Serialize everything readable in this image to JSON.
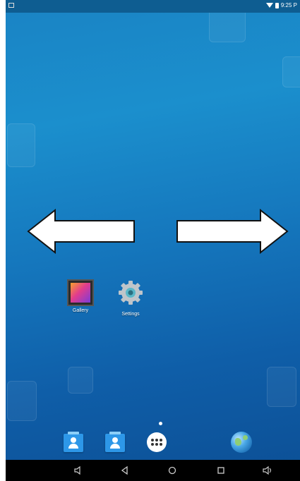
{
  "status_bar": {
    "time": "9:25 P",
    "icons": [
      "notification-icon",
      "wifi-icon",
      "battery-icon"
    ]
  },
  "gestures": {
    "arrows": [
      "arrow-left-icon",
      "arrow-right-icon"
    ]
  },
  "home_apps": [
    {
      "label": "Gallery",
      "icon": "gallery-icon"
    },
    {
      "label": "Settings",
      "icon": "settings-icon"
    }
  ],
  "dock": {
    "items": [
      "contacts-icon",
      "contacts-icon",
      "app-launcher-icon",
      "browser-icon"
    ]
  },
  "nav_bar": {
    "buttons": [
      "volume-down-icon",
      "back-icon",
      "home-icon",
      "recents-icon",
      "volume-up-icon"
    ]
  },
  "colors": {
    "wallpaper_top": "#1a83c4",
    "wallpaper_bottom": "#0c4f95",
    "nav_bar": "#000000"
  }
}
